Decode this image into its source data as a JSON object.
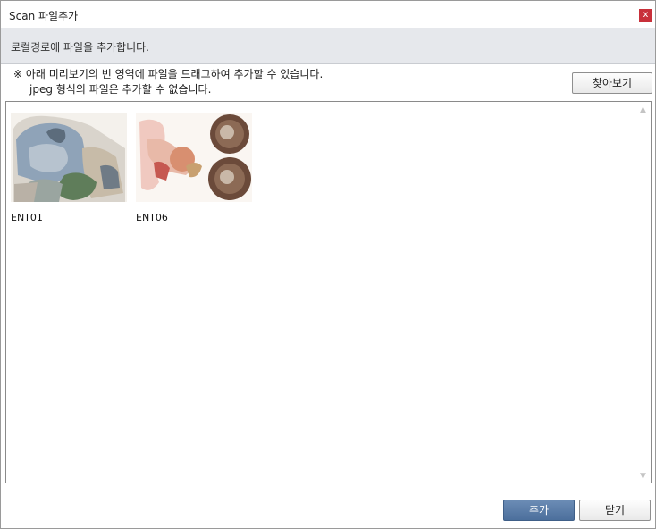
{
  "window": {
    "title": "Scan 파일추가",
    "close_label": "x"
  },
  "info": {
    "text": "로컬경로에 파일을 추가합니다."
  },
  "notes": {
    "line1": "※ 아래 미리보기의 빈 영역에 파일을 드래그하여 추가할 수 있습니다.",
    "line2": "jpeg 형식의 파일은 추가할 수 없습니다."
  },
  "browse_button": "찾아보기",
  "preview": {
    "files": [
      {
        "name": "ENT01"
      },
      {
        "name": "ENT06"
      }
    ],
    "scroll_up": "▲",
    "scroll_down": "▼"
  },
  "footer": {
    "add_label": "추가",
    "close_label": "닫기"
  },
  "colors": {
    "info_bar": "#e6e8ec",
    "add_button": "#5a7ca8",
    "close_button": "#c8303a"
  }
}
